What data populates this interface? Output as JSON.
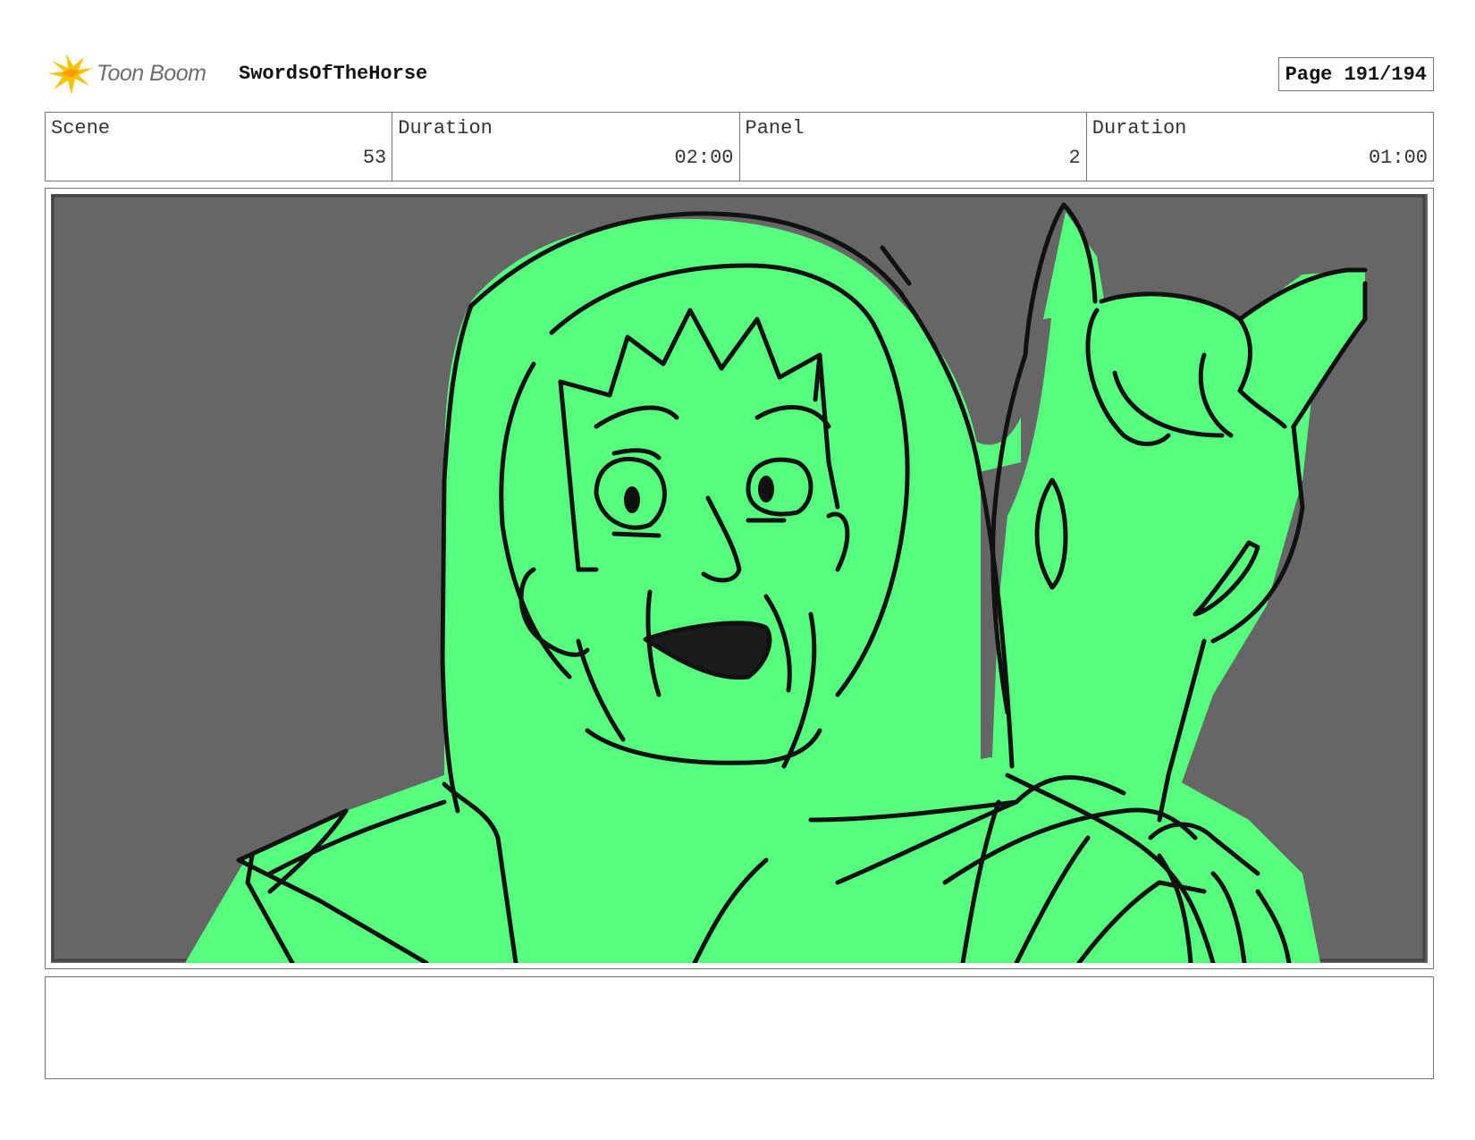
{
  "header": {
    "logo_text": "Toon Boom",
    "project_title": "SwordsOfTheHorse",
    "page_label": "Page 191/194"
  },
  "info": {
    "scene_label": "Scene",
    "scene_value": "53",
    "scene_duration_label": "Duration",
    "scene_duration_value": "02:00",
    "panel_label": "Panel",
    "panel_value": "2",
    "panel_duration_label": "Duration",
    "panel_duration_value": "01:00"
  },
  "notes": {
    "text": ""
  },
  "colors": {
    "fill": "#57ff7e",
    "background": "#666666",
    "ink": "#111111",
    "logo_flame": "#f5c400"
  }
}
